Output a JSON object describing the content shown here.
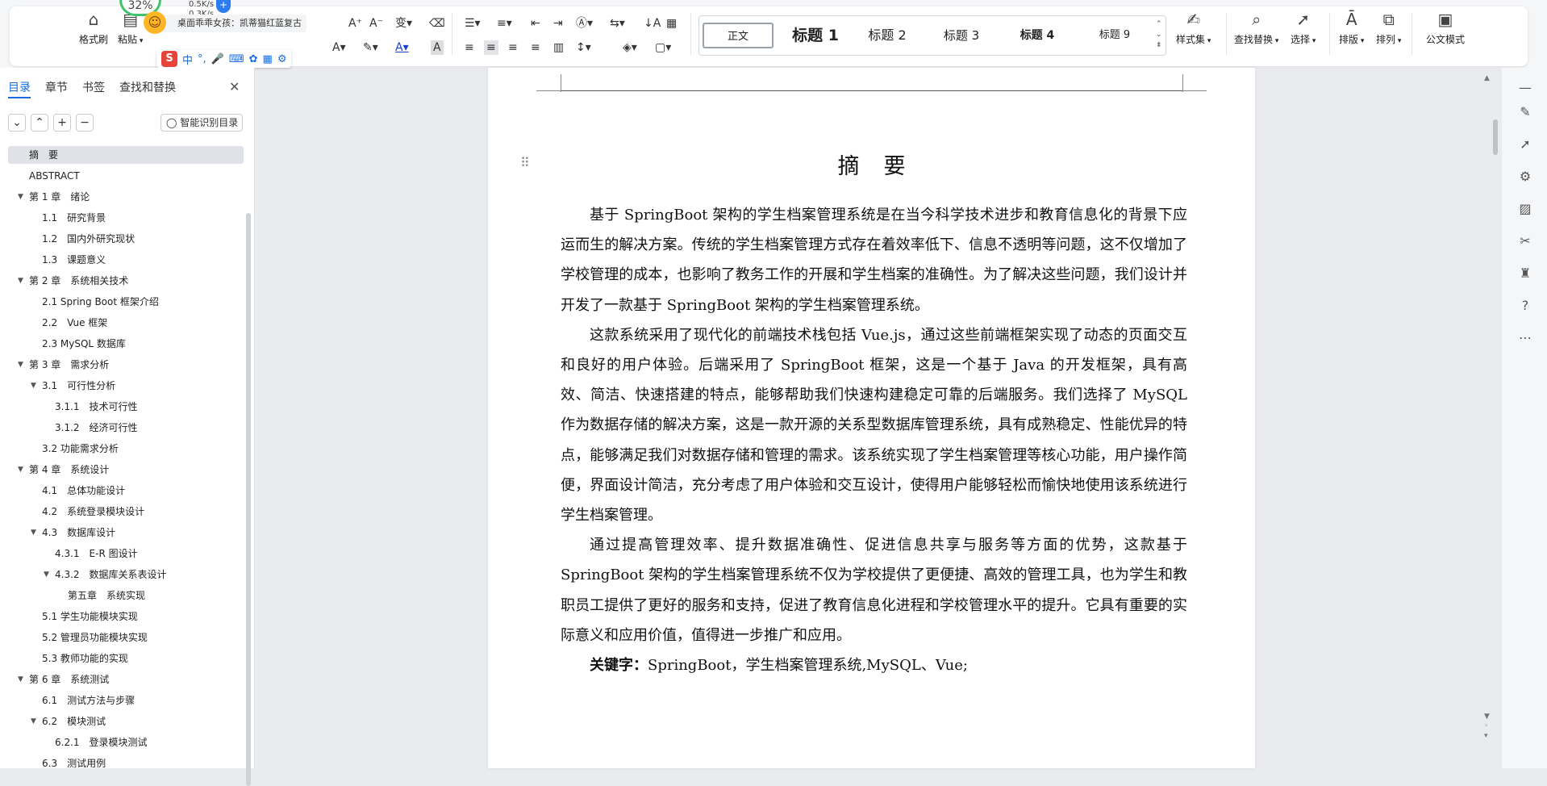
{
  "overlay": {
    "cpu_percent": "32%",
    "net_up": "0.5K/s",
    "net_down": "0.3K/s",
    "media_text": "桌面乖乖女孩：凯蒂猫红蓝复古",
    "ime_logo": "S",
    "ime_mode": "中",
    "ime_punct": "°,"
  },
  "ribbon": {
    "format_brush": "格式刷",
    "paste": "粘贴",
    "style_set": "样式集",
    "find_replace": "查找替换",
    "select": "选择",
    "layout": "排版",
    "arrange": "排列",
    "official_mode": "公文模式",
    "styles": [
      {
        "label": "正文"
      },
      {
        "label": "标题 1"
      },
      {
        "label": "标题 2"
      },
      {
        "label": "标题 3"
      },
      {
        "label": "标题 4"
      },
      {
        "label": "标题 9"
      }
    ]
  },
  "panel": {
    "tabs": [
      "目录",
      "章节",
      "书签",
      "查找和替换"
    ],
    "smart_toc": "智能识别目录",
    "toc": [
      {
        "text": "摘　要",
        "indent": 0,
        "arrow": false,
        "selected": true
      },
      {
        "text": "ABSTRACT",
        "indent": 0,
        "arrow": false
      },
      {
        "text": "第 1 章　绪论",
        "indent": 0,
        "arrow": true
      },
      {
        "text": "1.1　研究背景",
        "indent": 1,
        "arrow": false
      },
      {
        "text": "1.2　国内外研究现状",
        "indent": 1,
        "arrow": false
      },
      {
        "text": "1.3　课题意义",
        "indent": 1,
        "arrow": false
      },
      {
        "text": "第 2 章　系统相关技术",
        "indent": 0,
        "arrow": true
      },
      {
        "text": "2.1 Spring Boot 框架介绍",
        "indent": 1,
        "arrow": false
      },
      {
        "text": "2.2　Vue 框架",
        "indent": 1,
        "arrow": false
      },
      {
        "text": "2.3 MySQL 数据库",
        "indent": 1,
        "arrow": false
      },
      {
        "text": "第 3 章　需求分析",
        "indent": 0,
        "arrow": true
      },
      {
        "text": "3.1　可行性分析",
        "indent": 1,
        "arrow": true
      },
      {
        "text": "3.1.1　技术可行性",
        "indent": 2,
        "arrow": false
      },
      {
        "text": "3.1.2　经济可行性",
        "indent": 2,
        "arrow": false
      },
      {
        "text": "3.2 功能需求分析",
        "indent": 1,
        "arrow": false
      },
      {
        "text": "第 4 章　系统设计",
        "indent": 0,
        "arrow": true
      },
      {
        "text": "4.1　总体功能设计",
        "indent": 1,
        "arrow": false
      },
      {
        "text": "4.2　系统登录模块设计",
        "indent": 1,
        "arrow": false
      },
      {
        "text": "4.3　数据库设计",
        "indent": 1,
        "arrow": true
      },
      {
        "text": "4.3.1　E-R 图设计",
        "indent": 2,
        "arrow": false
      },
      {
        "text": "4.3.2　数据库关系表设计",
        "indent": 2,
        "arrow": true
      },
      {
        "text": "第五章　系统实现",
        "indent": 3,
        "arrow": false
      },
      {
        "text": "5.1 学生功能模块实现",
        "indent": 1,
        "arrow": false
      },
      {
        "text": "5.2 管理员功能模块实现",
        "indent": 1,
        "arrow": false
      },
      {
        "text": "5.3 教师功能的实现",
        "indent": 1,
        "arrow": false
      },
      {
        "text": "第 6 章　系统测试",
        "indent": 0,
        "arrow": true
      },
      {
        "text": "6.1　测试方法与步骤",
        "indent": 1,
        "arrow": false
      },
      {
        "text": "6.2　模块测试",
        "indent": 1,
        "arrow": true
      },
      {
        "text": "6.2.1　登录模块测试",
        "indent": 2,
        "arrow": false
      },
      {
        "text": "6.3　测试用例",
        "indent": 1,
        "arrow": false
      }
    ]
  },
  "document": {
    "title": "摘要",
    "paragraphs": [
      "基于 SpringBoot 架构的学生档案管理系统是在当今科学技术进步和教育信息化的背景下应运而生的解决方案。传统的学生档案管理方式存在着效率低下、信息不透明等问题，这不仅增加了学校管理的成本，也影响了教务工作的开展和学生档案的准确性。为了解决这些问题，我们设计并开发了一款基于 SpringBoot 架构的学生档案管理系统。",
      "这款系统采用了现代化的前端技术栈包括 Vue.js，通过这些前端框架实现了动态的页面交互和良好的用户体验。后端采用了 SpringBoot 框架，这是一个基于 Java 的开发框架，具有高效、简洁、快速搭建的特点，能够帮助我们快速构建稳定可靠的后端服务。我们选择了 MySQL 作为数据存储的解决方案，这是一款开源的关系型数据库管理系统，具有成熟稳定、性能优异的特点，能够满足我们对数据存储和管理的需求。该系统实现了学生档案管理等核心功能，用户操作简便，界面设计简洁，充分考虑了用户体验和交互设计，使得用户能够轻松而愉快地使用该系统进行学生档案管理。",
      "通过提高管理效率、提升数据准确性、促进信息共享与服务等方面的优势，这款基于 SpringBoot 架构的学生档案管理系统不仅为学校提供了更便捷、高效的管理工具，也为学生和教职员工提供了更好的服务和支持，促进了教育信息化进程和学校管理水平的提升。它具有重要的实际意义和应用价值，值得进一步推广和应用。"
    ],
    "keywords_label": "关键字：",
    "keywords": "SpringBoot，学生档案管理系统,MySQL、Vue;"
  }
}
